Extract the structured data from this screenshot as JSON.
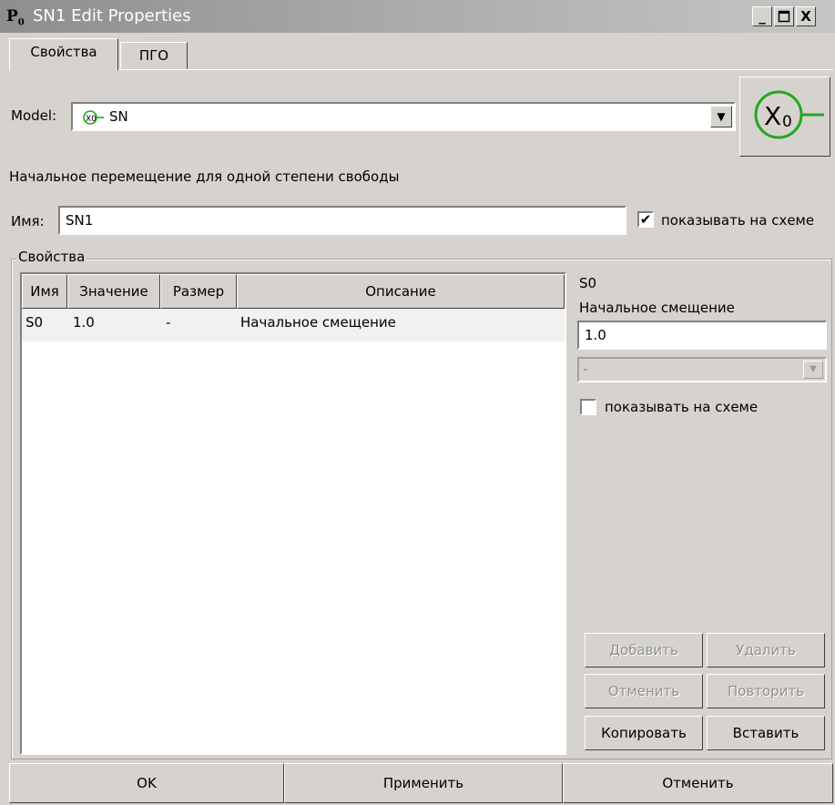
{
  "window": {
    "title": "SN1 Edit Properties",
    "minimize": "_",
    "close": "X"
  },
  "tabs": [
    {
      "label": "Свойства"
    },
    {
      "label": "ПГО"
    }
  ],
  "model": {
    "label": "Model:",
    "value": "SN"
  },
  "description": "Начальное перемещение для одной степени свободы",
  "name": {
    "label": "Имя:",
    "value": "SN1",
    "show_on_scheme_label": "показывать на схеме",
    "show_on_scheme_checked": true
  },
  "properties": {
    "group_label": "Свойства",
    "columns": [
      "Имя",
      "Значение",
      "Размер",
      "Описание"
    ],
    "rows": [
      {
        "name": "S0",
        "value": "1.0",
        "size": "-",
        "description": "Начальное смещение"
      }
    ]
  },
  "selected_property": {
    "name": "S0",
    "description": "Начальное смещение",
    "value": "1.0",
    "unit": "-",
    "show_on_scheme_label": "показывать на схеме",
    "show_on_scheme_checked": false
  },
  "side_buttons": {
    "add": "Добавить",
    "delete": "Удалить",
    "undo": "Отменить",
    "redo": "Повторить",
    "copy": "Копировать",
    "paste": "Вставить"
  },
  "footer": {
    "ok": "OK",
    "apply": "Применить",
    "cancel": "Отменить"
  },
  "colors": {
    "accent_green": "#22a822",
    "titlebar": "#9a9a9a",
    "dialog_bg": "#d6d3ce"
  }
}
